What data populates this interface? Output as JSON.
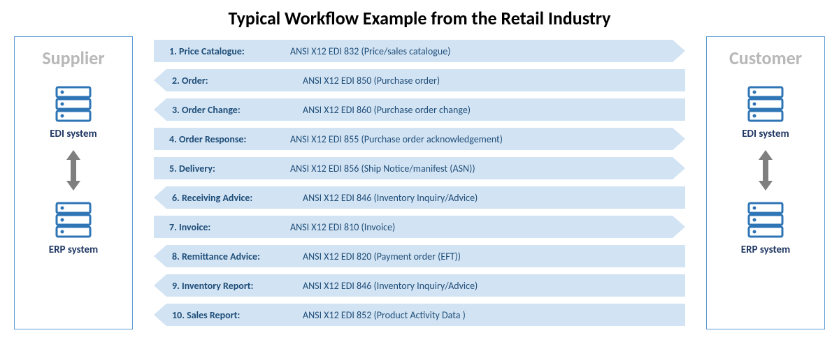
{
  "title": "Typical Workflow Example from the Retail Industry",
  "supplier": {
    "heading": "Supplier",
    "edi_label": "EDI system",
    "erp_label": "ERP system"
  },
  "customer": {
    "heading": "Customer",
    "edi_label": "EDI system",
    "erp_label": "ERP system"
  },
  "flows": [
    {
      "dir": "right",
      "label": "1. Price Catalogue:",
      "desc": "ANSI X12 EDI 832 (Price/sales catalogue)"
    },
    {
      "dir": "left",
      "label": "2. Order:",
      "desc": "ANSI X12 EDI 850 (Purchase order)"
    },
    {
      "dir": "left",
      "label": "3. Order Change:",
      "desc": "ANSI X12 EDI 860 (Purchase order change)"
    },
    {
      "dir": "right",
      "label": "4. Order Response:",
      "desc": "ANSI X12 EDI 855 (Purchase order acknowledgement)"
    },
    {
      "dir": "right",
      "label": "5. Delivery:",
      "desc": "ANSI X12 EDI 856 (Ship Notice/manifest (ASN))"
    },
    {
      "dir": "left",
      "label": "6. Receiving Advice:",
      "desc": "ANSI X12 EDI 846 (Inventory Inquiry/Advice)"
    },
    {
      "dir": "right",
      "label": "7. Invoice:",
      "desc": "ANSI X12 EDI 810 (Invoice)"
    },
    {
      "dir": "left",
      "label": "8. Remittance Advice:",
      "desc": "ANSI X12 EDI 820 (Payment order (EFT))"
    },
    {
      "dir": "left",
      "label": "9. Inventory Report:",
      "desc": "ANSI X12 EDI 846 (Inventory Inquiry/Advice)"
    },
    {
      "dir": "left",
      "label": "10. Sales Report:",
      "desc": "ANSI X12 EDI 852 (Product Activity Data )"
    }
  ]
}
